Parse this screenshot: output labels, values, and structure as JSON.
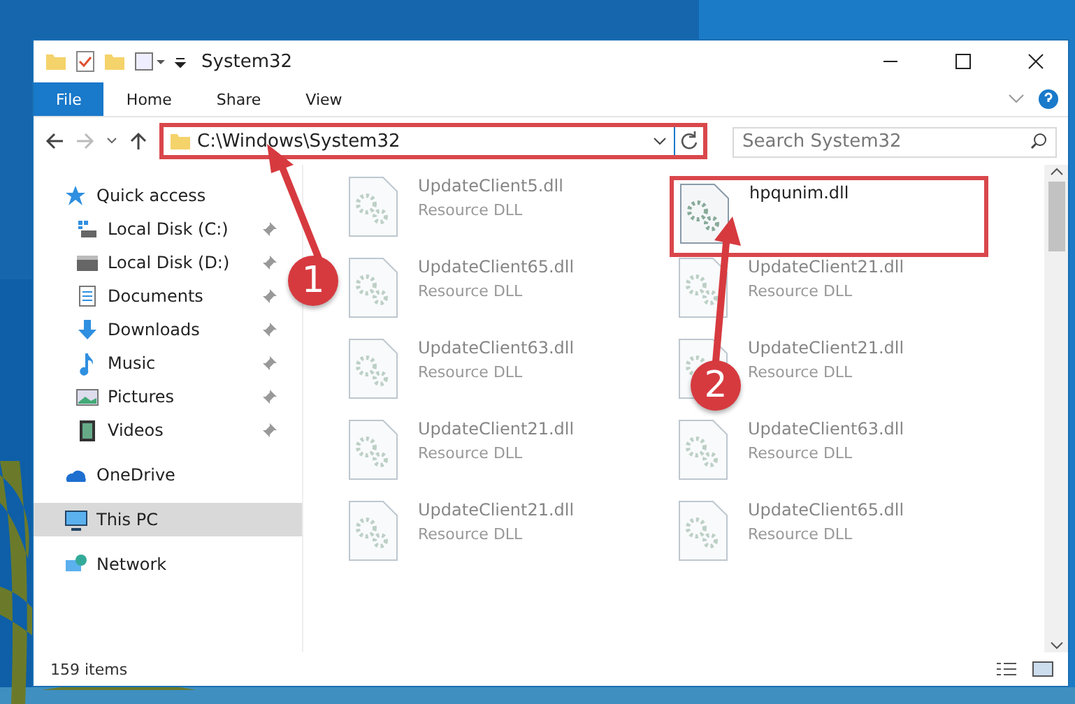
{
  "window": {
    "title": "System32"
  },
  "ribbon": {
    "tabs": [
      {
        "label": "File",
        "selected": true
      },
      {
        "label": "Home",
        "selected": false
      },
      {
        "label": "Share",
        "selected": false
      },
      {
        "label": "View",
        "selected": false
      }
    ]
  },
  "address": {
    "path": "C:\\Windows\\System32",
    "highlighted": true
  },
  "search": {
    "placeholder": "Search System32"
  },
  "sidebar": {
    "items": [
      {
        "label": "Quick access",
        "kind": "star",
        "selected": false,
        "children": [
          {
            "label": "Local Disk (C:)",
            "kind": "systemdrive",
            "pinned": true
          },
          {
            "label": "Local Disk (D:)",
            "kind": "drive",
            "pinned": true
          },
          {
            "label": "Documents",
            "kind": "documents",
            "pinned": true
          },
          {
            "label": "Downloads",
            "kind": "downloads",
            "pinned": true
          },
          {
            "label": "Music",
            "kind": "music",
            "pinned": true
          },
          {
            "label": "Pictures",
            "kind": "pictures",
            "pinned": true
          },
          {
            "label": "Videos",
            "kind": "videos",
            "pinned": true
          }
        ]
      },
      {
        "label": "OneDrive",
        "kind": "cloud",
        "selected": false
      },
      {
        "label": "This PC",
        "kind": "computer",
        "selected": true
      },
      {
        "label": "Network",
        "kind": "network",
        "selected": false
      }
    ]
  },
  "files": [
    {
      "name": "UpdateClient5.dll",
      "type": "Resource DLL",
      "dimmed": true,
      "highlighted": false
    },
    {
      "name": "hpqunim.dll",
      "dimmed": false,
      "highlighted": true
    },
    {
      "name": "UpdateClient65.dll",
      "type": "Resource DLL",
      "dimmed": true,
      "highlighted": false
    },
    {
      "name": "UpdateClient21.dll",
      "type": "Resource DLL",
      "dimmed": true,
      "highlighted": false
    },
    {
      "name": "UpdateClient63.dll",
      "type": "Resource DLL",
      "dimmed": true,
      "highlighted": false
    },
    {
      "name": "UpdateClient21.dll",
      "type": "Resource DLL",
      "dimmed": true,
      "highlighted": false
    },
    {
      "name": "UpdateClient21.dll",
      "type": "Resource DLL",
      "dimmed": true,
      "highlighted": false
    },
    {
      "name": "UpdateClient63.dll",
      "type": "Resource DLL",
      "dimmed": true,
      "highlighted": false
    },
    {
      "name": "UpdateClient21.dll",
      "type": "Resource DLL",
      "dimmed": true,
      "highlighted": false
    },
    {
      "name": "UpdateClient65.dll",
      "type": "Resource DLL",
      "dimmed": true,
      "highlighted": false
    }
  ],
  "annotations": [
    {
      "label": "1"
    },
    {
      "label": "2"
    }
  ],
  "status_bar": {
    "count": "159 items"
  }
}
